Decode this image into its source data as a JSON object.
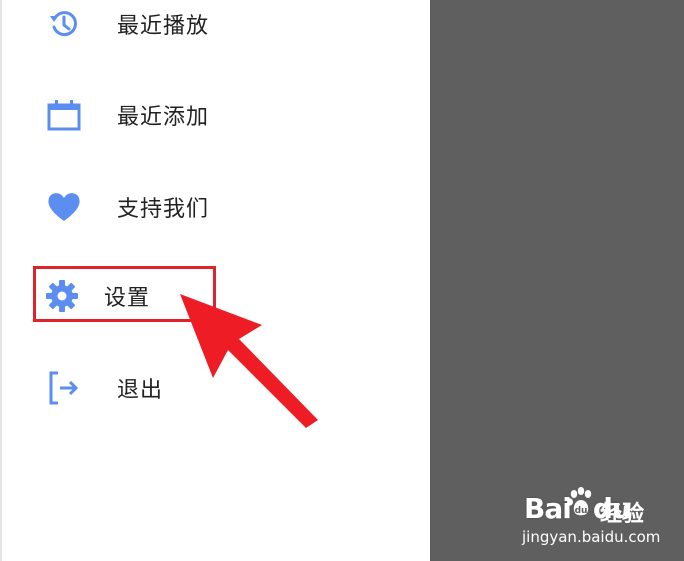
{
  "menu": {
    "items": [
      {
        "label": "最近播放",
        "icon": "history-icon"
      },
      {
        "label": "最近添加",
        "icon": "calendar-icon"
      },
      {
        "label": "支持我们",
        "icon": "heart-icon"
      },
      {
        "label": "设置",
        "icon": "gear-icon"
      },
      {
        "label": "退出",
        "icon": "logout-icon"
      }
    ]
  },
  "colors": {
    "accent": "#5b8ef0",
    "highlight": "#e0222a",
    "scrim": "#5f5f5f"
  },
  "watermark": {
    "logo_text_a": "Bai",
    "logo_text_b": "du",
    "cn_text": "经验",
    "url": "jingyan.baidu.com"
  }
}
